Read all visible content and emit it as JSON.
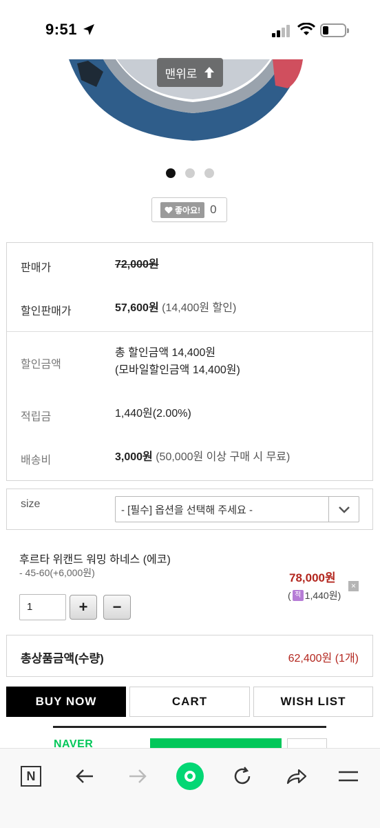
{
  "status_bar": {
    "time": "9:51"
  },
  "product_image": {
    "scroll_top_label": "맨위로",
    "slide_count": 3,
    "active_slide": 1
  },
  "like": {
    "label": "좋아요!",
    "count": "0"
  },
  "price": {
    "sale_price_label": "판매가",
    "sale_price": "72,000원",
    "discount_price_label": "할인판매가",
    "discount_price": "57,600원",
    "discount_note": "(14,400원 할인)",
    "discount_total_label": "할인금액",
    "discount_total_line1": "총 할인금액 14,400원",
    "discount_total_line2": "(모바일할인금액 14,400원)",
    "points_label": "적립금",
    "points_value": "1,440원(2.00%)",
    "shipping_label": "배송비",
    "shipping_value": "3,000원",
    "shipping_note": "(50,000원 이상 구매 시 무료)"
  },
  "option": {
    "label": "size",
    "select_value": "- [필수] 옵션을 선택해 주세요 -"
  },
  "selected_item": {
    "name": "후르타 위캔드 워밍 하네스 (에코)",
    "option": "- 45-60(+6,000원)",
    "price": "78,000원",
    "points_open": "(",
    "points_icon_text": "적",
    "points_value": "1,440원)",
    "remove_symbol": "×",
    "quantity": "1",
    "plus_label": "+",
    "minus_label": "−"
  },
  "total": {
    "label": "총상품금액(수량)",
    "value": "62,400원 (1개)"
  },
  "actions": {
    "buy_now": "BUY NOW",
    "cart": "CART",
    "wish_list": "WISH LIST"
  },
  "naver": {
    "logo_text": "NAVER"
  },
  "bottom_nav": {
    "n_label": "N",
    "icons": [
      "n-icon",
      "back-arrow-icon",
      "forward-arrow-icon",
      "home-icon",
      "refresh-icon",
      "share-icon",
      "menu-icon"
    ]
  },
  "colors": {
    "accent_red": "#b3261e",
    "naver_green": "#03c75a",
    "buy_black": "#000000"
  }
}
